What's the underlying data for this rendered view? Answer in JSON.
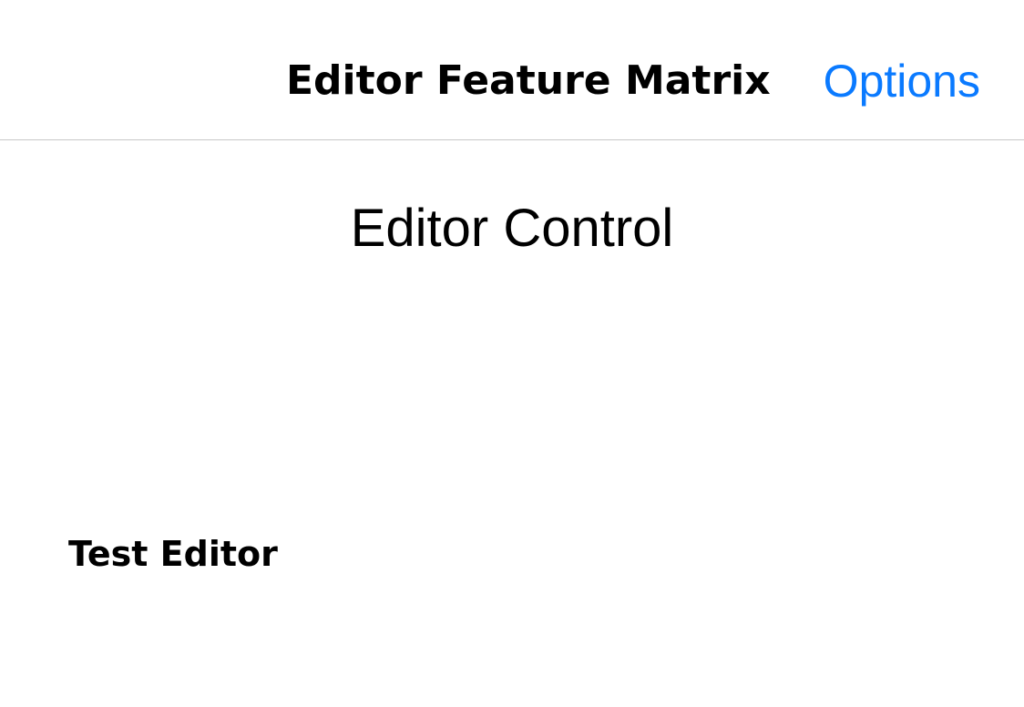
{
  "nav": {
    "title": "Editor Feature Matrix",
    "options_label": "Options"
  },
  "main": {
    "section_title": "Editor Control",
    "editor_label": "Test Editor"
  },
  "colors": {
    "accent": "#0a7aff",
    "separator": "#c8c8c8",
    "background": "#ffffff",
    "text": "#000000"
  }
}
